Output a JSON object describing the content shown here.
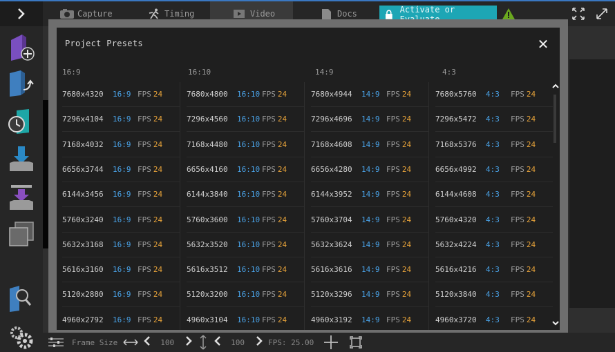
{
  "topbar": {
    "tabs": [
      {
        "label": "Capture",
        "icon": "camera-icon"
      },
      {
        "label": "Timing",
        "icon": "running-person-icon"
      },
      {
        "label": "Video",
        "icon": "play-icon"
      },
      {
        "label": "Docs",
        "icon": "document-icon"
      }
    ],
    "active_tab": "Video",
    "activate_label": "Activate or Evaluate",
    "accent_color": "#1da6b5",
    "warning_color": "#6aa81e"
  },
  "modal": {
    "title": "Project Presets",
    "close_symbol": "✕",
    "fps_label": "FPS",
    "columns": [
      {
        "header": "16:9",
        "ratio": "16:9",
        "rows": [
          {
            "res": "7680x4320",
            "fps": "24"
          },
          {
            "res": "7296x4104",
            "fps": "24"
          },
          {
            "res": "7168x4032",
            "fps": "24"
          },
          {
            "res": "6656x3744",
            "fps": "24"
          },
          {
            "res": "6144x3456",
            "fps": "24"
          },
          {
            "res": "5760x3240",
            "fps": "24"
          },
          {
            "res": "5632x3168",
            "fps": "24"
          },
          {
            "res": "5616x3160",
            "fps": "24"
          },
          {
            "res": "5120x2880",
            "fps": "24"
          },
          {
            "res": "4960x2792",
            "fps": "24"
          }
        ]
      },
      {
        "header": "16:10",
        "ratio": "16:10",
        "rows": [
          {
            "res": "7680x4800",
            "fps": "24"
          },
          {
            "res": "7296x4560",
            "fps": "24"
          },
          {
            "res": "7168x4480",
            "fps": "24"
          },
          {
            "res": "6656x4160",
            "fps": "24"
          },
          {
            "res": "6144x3840",
            "fps": "24"
          },
          {
            "res": "5760x3600",
            "fps": "24"
          },
          {
            "res": "5632x3520",
            "fps": "24"
          },
          {
            "res": "5616x3512",
            "fps": "24"
          },
          {
            "res": "5120x3200",
            "fps": "24"
          },
          {
            "res": "4960x3104",
            "fps": "24"
          }
        ]
      },
      {
        "header": "14:9",
        "ratio": "14:9",
        "rows": [
          {
            "res": "7680x4944",
            "fps": "24"
          },
          {
            "res": "7296x4696",
            "fps": "24"
          },
          {
            "res": "7168x4608",
            "fps": "24"
          },
          {
            "res": "6656x4280",
            "fps": "24"
          },
          {
            "res": "6144x3952",
            "fps": "24"
          },
          {
            "res": "5760x3704",
            "fps": "24"
          },
          {
            "res": "5632x3624",
            "fps": "24"
          },
          {
            "res": "5616x3616",
            "fps": "24"
          },
          {
            "res": "5120x3296",
            "fps": "24"
          },
          {
            "res": "4960x3192",
            "fps": "24"
          }
        ]
      },
      {
        "header": "4:3",
        "ratio": "4:3",
        "rows": [
          {
            "res": "7680x5760",
            "fps": "24"
          },
          {
            "res": "7296x5472",
            "fps": "24"
          },
          {
            "res": "7168x5376",
            "fps": "24"
          },
          {
            "res": "6656x4992",
            "fps": "24"
          },
          {
            "res": "6144x4608",
            "fps": "24"
          },
          {
            "res": "5760x4320",
            "fps": "24"
          },
          {
            "res": "5632x4224",
            "fps": "24"
          },
          {
            "res": "5616x4216",
            "fps": "24"
          },
          {
            "res": "5120x3840",
            "fps": "24"
          },
          {
            "res": "4960x3720",
            "fps": "24"
          }
        ]
      }
    ],
    "colors": {
      "ratio": "#4aa3e8",
      "fps_value": "#e8a33a"
    }
  },
  "bottombar": {
    "frame_size_label": "Frame Size",
    "width_value": "100",
    "height_value": "100",
    "fps_readout": "FPS: 25.00"
  }
}
